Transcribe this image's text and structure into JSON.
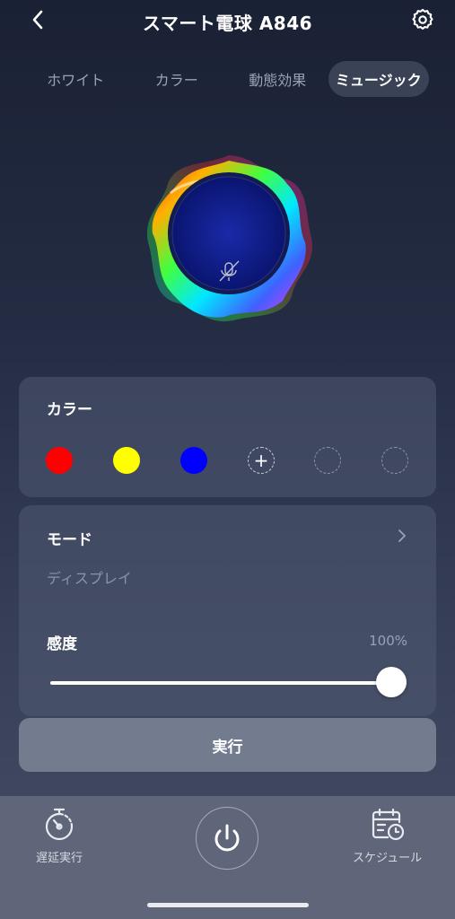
{
  "header": {
    "title": "スマート電球 A846"
  },
  "tabs": [
    {
      "label": "ホワイト",
      "active": false
    },
    {
      "label": "カラー",
      "active": false
    },
    {
      "label": "動態効果",
      "active": false
    },
    {
      "label": "ミュージック",
      "active": true
    }
  ],
  "color_card": {
    "title": "カラー",
    "swatches": [
      "#ff0000",
      "#ffff00",
      "#0000ff"
    ],
    "add_label": "+"
  },
  "mode_card": {
    "mode_label": "モード",
    "mode_value": "ディスプレイ",
    "sensitivity_label": "感度",
    "sensitivity_value": "100%",
    "sensitivity_level": 1.0
  },
  "run_button": {
    "label": "実行"
  },
  "bottom_bar": {
    "delay_label": "遅延実行",
    "schedule_label": "スケジュール"
  },
  "icons": [
    "back-icon",
    "gear-icon",
    "mic-muted-icon",
    "chevron-right-icon",
    "stopwatch-icon",
    "power-icon",
    "calendar-clock-icon"
  ]
}
